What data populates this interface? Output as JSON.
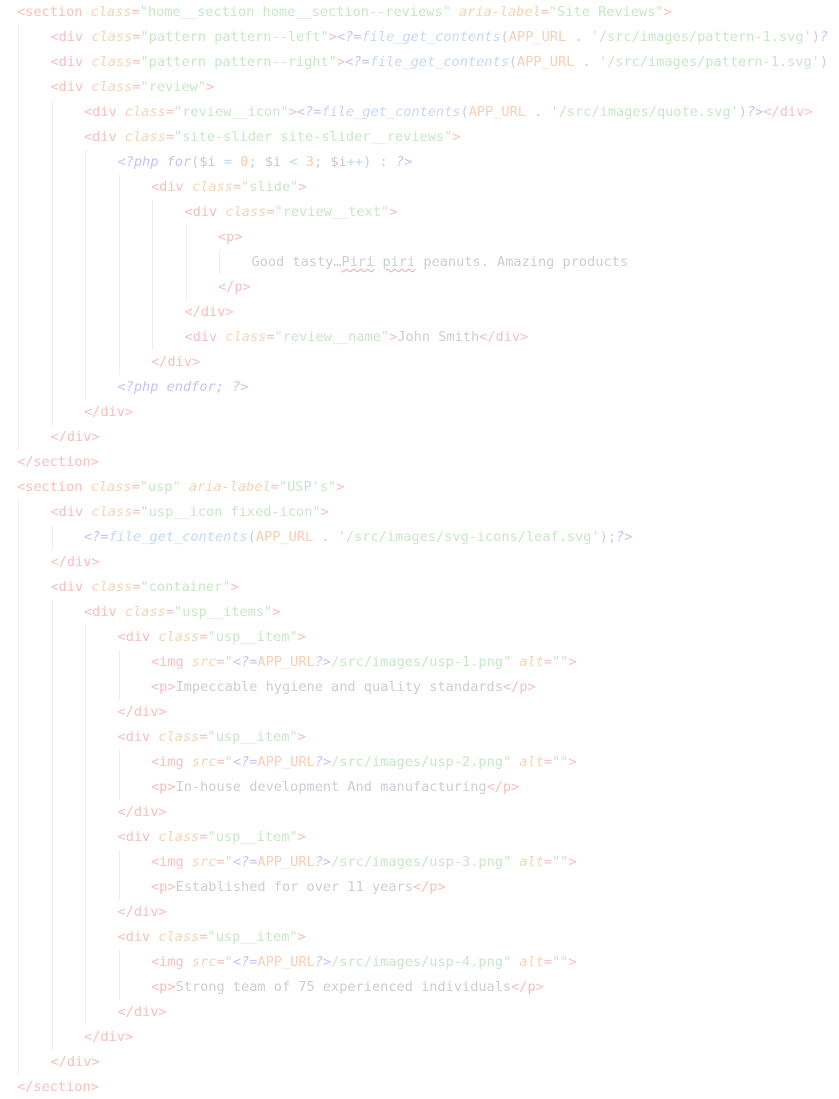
{
  "editor": {
    "language": "php/html",
    "colors": {
      "background": "#ffffff",
      "tag": "#f7bfbf",
      "attribute": "#f6d4b2",
      "string": "#c8e7c7",
      "php": "#cdbff5",
      "function": "#c6d8f7",
      "constant": "#f8cfb5",
      "number": "#f9c9a8",
      "text": "#cbced4"
    },
    "lines": [
      {
        "indent": 0,
        "tokens": [
          [
            "tag",
            "<section "
          ],
          [
            "attr",
            "class"
          ],
          [
            "tag",
            "="
          ],
          [
            "str",
            "\"home__section home__section--reviews\" "
          ],
          [
            "attr",
            "aria-label"
          ],
          [
            "tag",
            "="
          ],
          [
            "str",
            "\"Site Reviews\""
          ],
          [
            "tag",
            ">"
          ]
        ]
      },
      {
        "indent": 1,
        "tokens": [
          [
            "tag",
            "<div "
          ],
          [
            "attr",
            "class"
          ],
          [
            "tag",
            "="
          ],
          [
            "str",
            "\"pattern pattern--left\""
          ],
          [
            "tag",
            ">"
          ],
          [
            "php",
            "<?="
          ],
          [
            "fn",
            "file_get_contents"
          ],
          [
            "pun",
            "("
          ],
          [
            "cnst",
            "APP_URL"
          ],
          [
            "pun",
            " . "
          ],
          [
            "str",
            "'/src/images/pattern-1.svg'"
          ],
          [
            "pun",
            ")"
          ],
          [
            "php",
            "?"
          ]
        ]
      },
      {
        "indent": 1,
        "tokens": [
          [
            "tag",
            "<div "
          ],
          [
            "attr",
            "class"
          ],
          [
            "tag",
            "="
          ],
          [
            "str",
            "\"pattern pattern--right\""
          ],
          [
            "tag",
            ">"
          ],
          [
            "php",
            "<?="
          ],
          [
            "fn",
            "file_get_contents"
          ],
          [
            "pun",
            "("
          ],
          [
            "cnst",
            "APP_URL"
          ],
          [
            "pun",
            " . "
          ],
          [
            "str",
            "'/src/images/pattern-1.svg'"
          ],
          [
            "pun",
            ")"
          ]
        ]
      },
      {
        "indent": 1,
        "tokens": [
          [
            "tag",
            "<div "
          ],
          [
            "attr",
            "class"
          ],
          [
            "tag",
            "="
          ],
          [
            "str",
            "\"review\""
          ],
          [
            "tag",
            ">"
          ]
        ]
      },
      {
        "indent": 2,
        "tokens": [
          [
            "tag",
            "<div "
          ],
          [
            "attr",
            "class"
          ],
          [
            "tag",
            "="
          ],
          [
            "str",
            "\"review__icon\""
          ],
          [
            "tag",
            ">"
          ],
          [
            "php",
            "<?="
          ],
          [
            "fn",
            "file_get_contents"
          ],
          [
            "pun",
            "("
          ],
          [
            "cnst",
            "APP_URL"
          ],
          [
            "pun",
            " . "
          ],
          [
            "str",
            "'/src/images/quote.svg'"
          ],
          [
            "pun",
            ")"
          ],
          [
            "php",
            "?>"
          ],
          [
            "tag",
            "</div>"
          ]
        ]
      },
      {
        "indent": 2,
        "tokens": [
          [
            "tag",
            "<div "
          ],
          [
            "attr",
            "class"
          ],
          [
            "tag",
            "="
          ],
          [
            "str",
            "\"site-slider site-slider__reviews\""
          ],
          [
            "tag",
            ">"
          ]
        ]
      },
      {
        "indent": 3,
        "tokens": [
          [
            "php",
            "<?php "
          ],
          [
            "php",
            "for"
          ],
          [
            "pun",
            "("
          ],
          [
            "var",
            "$i"
          ],
          [
            "op",
            " = "
          ],
          [
            "num",
            "0"
          ],
          [
            "pun",
            "; "
          ],
          [
            "var",
            "$i"
          ],
          [
            "op",
            " < "
          ],
          [
            "num",
            "3"
          ],
          [
            "pun",
            "; "
          ],
          [
            "var",
            "$i"
          ],
          [
            "op",
            "++"
          ],
          [
            "pun",
            ") : "
          ],
          [
            "php",
            "?>"
          ]
        ]
      },
      {
        "indent": 4,
        "tokens": [
          [
            "tag",
            "<div "
          ],
          [
            "attr",
            "class"
          ],
          [
            "tag",
            "="
          ],
          [
            "str",
            "\"slide\""
          ],
          [
            "tag",
            ">"
          ]
        ]
      },
      {
        "indent": 5,
        "tokens": [
          [
            "tag",
            "<div "
          ],
          [
            "attr",
            "class"
          ],
          [
            "tag",
            "="
          ],
          [
            "str",
            "\"review__text\""
          ],
          [
            "tag",
            ">"
          ]
        ]
      },
      {
        "indent": 6,
        "tokens": [
          [
            "tag",
            "<p>"
          ]
        ]
      },
      {
        "indent": 7,
        "tokens": [
          [
            "txt",
            "Good tasty…"
          ],
          [
            "txtsq",
            "Piri"
          ],
          [
            "txt",
            " "
          ],
          [
            "txtsq",
            "piri"
          ],
          [
            "txt",
            " peanuts. Amazing products"
          ]
        ]
      },
      {
        "indent": 6,
        "tokens": [
          [
            "tag",
            "</p>"
          ]
        ]
      },
      {
        "indent": 5,
        "tokens": [
          [
            "tag",
            "</div>"
          ]
        ]
      },
      {
        "indent": 5,
        "tokens": [
          [
            "tag",
            "<div "
          ],
          [
            "attr",
            "class"
          ],
          [
            "tag",
            "="
          ],
          [
            "str",
            "\"review__name\""
          ],
          [
            "tag",
            ">"
          ],
          [
            "txt",
            "John Smith"
          ],
          [
            "tag",
            "</div>"
          ]
        ]
      },
      {
        "indent": 4,
        "tokens": [
          [
            "tag",
            "</div>"
          ]
        ]
      },
      {
        "indent": 3,
        "tokens": [
          [
            "php",
            "<?php endfor; ?>"
          ]
        ]
      },
      {
        "indent": 2,
        "tokens": [
          [
            "tag",
            "</div>"
          ]
        ]
      },
      {
        "indent": 1,
        "tokens": [
          [
            "tag",
            "</div>"
          ]
        ]
      },
      {
        "indent": 0,
        "tokens": [
          [
            "tag",
            "</section>"
          ]
        ]
      },
      {
        "indent": 0,
        "tokens": [
          [
            "tag",
            "<section "
          ],
          [
            "attr",
            "class"
          ],
          [
            "tag",
            "="
          ],
          [
            "str",
            "\"usp\" "
          ],
          [
            "attr",
            "aria-label"
          ],
          [
            "tag",
            "="
          ],
          [
            "str",
            "\"USP's\""
          ],
          [
            "tag",
            ">"
          ]
        ]
      },
      {
        "indent": 1,
        "tokens": [
          [
            "tag",
            "<div "
          ],
          [
            "attr",
            "class"
          ],
          [
            "tag",
            "="
          ],
          [
            "str",
            "\"usp__icon fixed-icon\""
          ],
          [
            "tag",
            ">"
          ]
        ]
      },
      {
        "indent": 2,
        "tokens": [
          [
            "php",
            "<?="
          ],
          [
            "fn",
            "file_get_contents"
          ],
          [
            "pun",
            "("
          ],
          [
            "cnst",
            "APP_URL"
          ],
          [
            "pun",
            " . "
          ],
          [
            "str",
            "'/src/images/svg-icons/leaf.svg'"
          ],
          [
            "pun",
            ");"
          ],
          [
            "php",
            "?>"
          ]
        ]
      },
      {
        "indent": 1,
        "tokens": [
          [
            "tag",
            "</div>"
          ]
        ]
      },
      {
        "indent": 1,
        "tokens": [
          [
            "tag",
            "<div "
          ],
          [
            "attr",
            "class"
          ],
          [
            "tag",
            "="
          ],
          [
            "str",
            "\"container\""
          ],
          [
            "tag",
            ">"
          ]
        ]
      },
      {
        "indent": 2,
        "tokens": [
          [
            "tag",
            "<div "
          ],
          [
            "attr",
            "class"
          ],
          [
            "tag",
            "="
          ],
          [
            "str",
            "\"usp__items\""
          ],
          [
            "tag",
            ">"
          ]
        ]
      },
      {
        "indent": 3,
        "tokens": [
          [
            "tag",
            "<div "
          ],
          [
            "attr",
            "class"
          ],
          [
            "tag",
            "="
          ],
          [
            "str",
            "\"usp__item\""
          ],
          [
            "tag",
            ">"
          ]
        ]
      },
      {
        "indent": 4,
        "tokens": [
          [
            "tag",
            "<img "
          ],
          [
            "attr",
            "src"
          ],
          [
            "tag",
            "="
          ],
          [
            "str",
            "\""
          ],
          [
            "php",
            "<?="
          ],
          [
            "cnst",
            "APP_URL"
          ],
          [
            "php",
            "?>"
          ],
          [
            "str",
            "/src/images/usp-1.png\" "
          ],
          [
            "attr",
            "alt"
          ],
          [
            "tag",
            "="
          ],
          [
            "str",
            "\"\""
          ],
          [
            "tag",
            ">"
          ]
        ]
      },
      {
        "indent": 4,
        "tokens": [
          [
            "tag",
            "<p>"
          ],
          [
            "txt",
            "Impeccable hygiene and quality standards"
          ],
          [
            "tag",
            "</p>"
          ]
        ]
      },
      {
        "indent": 3,
        "tokens": [
          [
            "tag",
            "</div>"
          ]
        ]
      },
      {
        "indent": 3,
        "tokens": [
          [
            "tag",
            "<div "
          ],
          [
            "attr",
            "class"
          ],
          [
            "tag",
            "="
          ],
          [
            "str",
            "\"usp__item\""
          ],
          [
            "tag",
            ">"
          ]
        ]
      },
      {
        "indent": 4,
        "tokens": [
          [
            "tag",
            "<img "
          ],
          [
            "attr",
            "src"
          ],
          [
            "tag",
            "="
          ],
          [
            "str",
            "\""
          ],
          [
            "php",
            "<?="
          ],
          [
            "cnst",
            "APP_URL"
          ],
          [
            "php",
            "?>"
          ],
          [
            "str",
            "/src/images/usp-2.png\" "
          ],
          [
            "attr",
            "alt"
          ],
          [
            "tag",
            "="
          ],
          [
            "str",
            "\"\""
          ],
          [
            "tag",
            ">"
          ]
        ]
      },
      {
        "indent": 4,
        "tokens": [
          [
            "tag",
            "<p>"
          ],
          [
            "txt",
            "In-house development And manufacturing"
          ],
          [
            "tag",
            "</p>"
          ]
        ]
      },
      {
        "indent": 3,
        "tokens": [
          [
            "tag",
            "</div>"
          ]
        ]
      },
      {
        "indent": 3,
        "tokens": [
          [
            "tag",
            "<div "
          ],
          [
            "attr",
            "class"
          ],
          [
            "tag",
            "="
          ],
          [
            "str",
            "\"usp__item\""
          ],
          [
            "tag",
            ">"
          ]
        ]
      },
      {
        "indent": 4,
        "tokens": [
          [
            "tag",
            "<img "
          ],
          [
            "attr",
            "src"
          ],
          [
            "tag",
            "="
          ],
          [
            "str",
            "\""
          ],
          [
            "php",
            "<?="
          ],
          [
            "cnst",
            "APP_URL"
          ],
          [
            "php",
            "?>"
          ],
          [
            "str",
            "/src/images/usp-3.png\" "
          ],
          [
            "attr",
            "alt"
          ],
          [
            "tag",
            "="
          ],
          [
            "str",
            "\"\""
          ],
          [
            "tag",
            ">"
          ]
        ]
      },
      {
        "indent": 4,
        "tokens": [
          [
            "tag",
            "<p>"
          ],
          [
            "txt",
            "Established for over 11 years"
          ],
          [
            "tag",
            "</p>"
          ]
        ]
      },
      {
        "indent": 3,
        "tokens": [
          [
            "tag",
            "</div>"
          ]
        ]
      },
      {
        "indent": 3,
        "tokens": [
          [
            "tag",
            "<div "
          ],
          [
            "attr",
            "class"
          ],
          [
            "tag",
            "="
          ],
          [
            "str",
            "\"usp__item\""
          ],
          [
            "tag",
            ">"
          ]
        ]
      },
      {
        "indent": 4,
        "tokens": [
          [
            "tag",
            "<img "
          ],
          [
            "attr",
            "src"
          ],
          [
            "tag",
            "="
          ],
          [
            "str",
            "\""
          ],
          [
            "php",
            "<?="
          ],
          [
            "cnst",
            "APP_URL"
          ],
          [
            "php",
            "?>"
          ],
          [
            "str",
            "/src/images/usp-4.png\" "
          ],
          [
            "attr",
            "alt"
          ],
          [
            "tag",
            "="
          ],
          [
            "str",
            "\"\""
          ],
          [
            "tag",
            ">"
          ]
        ]
      },
      {
        "indent": 4,
        "tokens": [
          [
            "tag",
            "<p>"
          ],
          [
            "txt",
            "Strong team of 75 experienced individuals"
          ],
          [
            "tag",
            "</p>"
          ]
        ]
      },
      {
        "indent": 3,
        "tokens": [
          [
            "tag",
            "</div>"
          ]
        ]
      },
      {
        "indent": 2,
        "tokens": [
          [
            "tag",
            "</div>"
          ]
        ]
      },
      {
        "indent": 1,
        "tokens": [
          [
            "tag",
            "</div>"
          ]
        ]
      },
      {
        "indent": 0,
        "tokens": [
          [
            "tag",
            "</section>"
          ]
        ]
      }
    ]
  }
}
